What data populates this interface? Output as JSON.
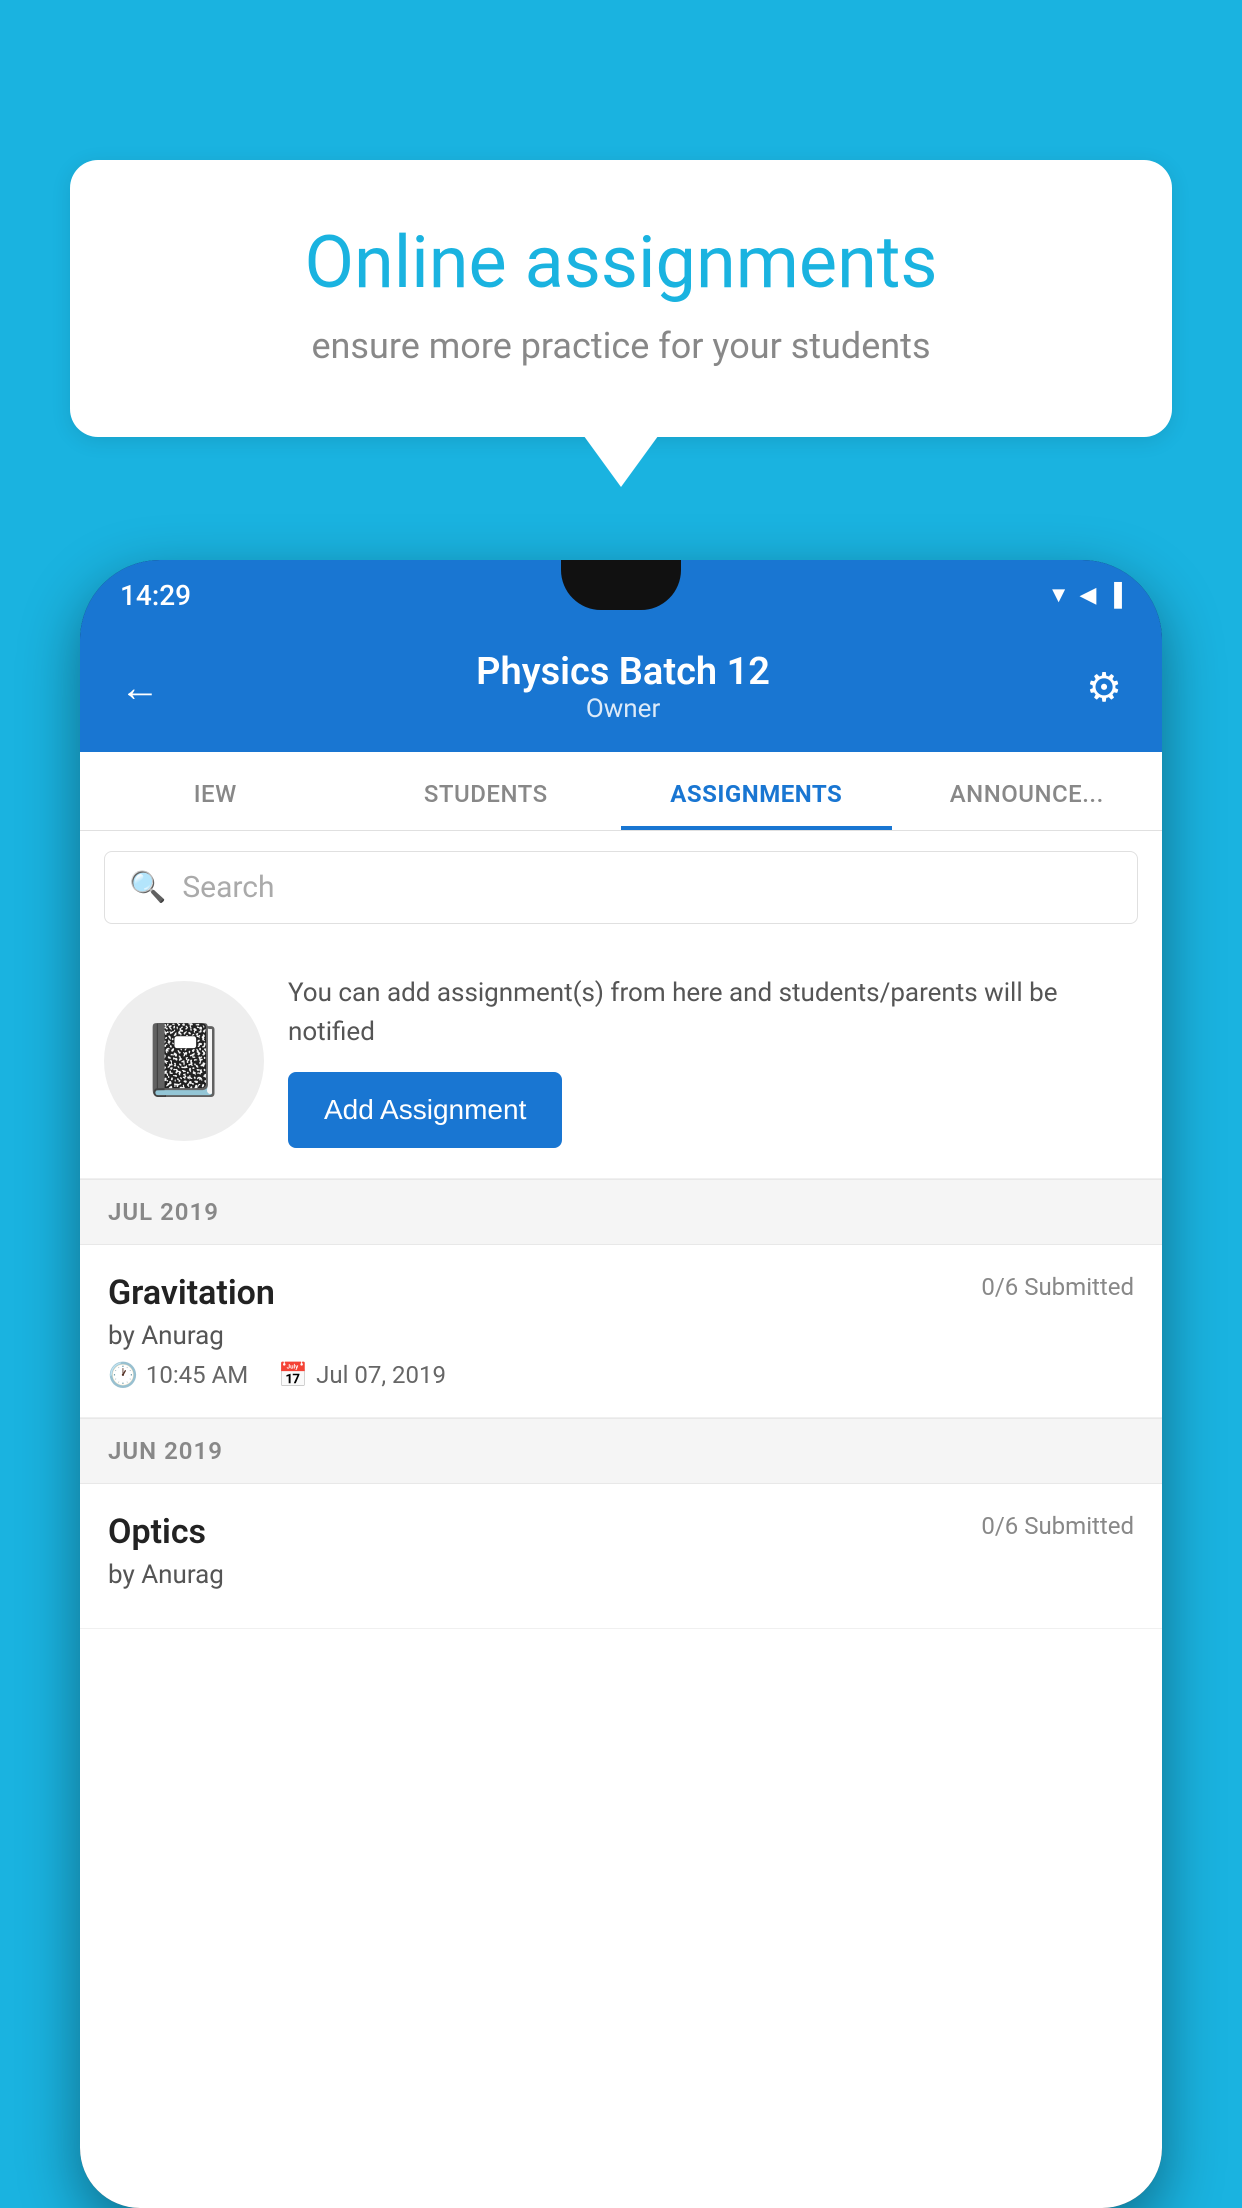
{
  "background_color": "#1ab3e0",
  "speech_bubble": {
    "title": "Online assignments",
    "subtitle": "ensure more practice for your students"
  },
  "phone": {
    "status_bar": {
      "time": "14:29",
      "icons": "▼◀▐"
    },
    "header": {
      "title": "Physics Batch 12",
      "subtitle": "Owner",
      "back_label": "←",
      "settings_label": "⚙"
    },
    "tabs": [
      {
        "label": "IEW",
        "active": false
      },
      {
        "label": "STUDENTS",
        "active": false
      },
      {
        "label": "ASSIGNMENTS",
        "active": true
      },
      {
        "label": "ANNOUNCEMENTS",
        "active": false
      }
    ],
    "search": {
      "placeholder": "Search"
    },
    "promo": {
      "icon": "📓",
      "text": "You can add assignment(s) from here and students/parents will be notified",
      "button_label": "Add Assignment"
    },
    "sections": [
      {
        "header": "JUL 2019",
        "items": [
          {
            "name": "Gravitation",
            "submitted": "0/6 Submitted",
            "by": "by Anurag",
            "time": "10:45 AM",
            "date": "Jul 07, 2019"
          }
        ]
      },
      {
        "header": "JUN 2019",
        "items": [
          {
            "name": "Optics",
            "submitted": "0/6 Submitted",
            "by": "by Anurag",
            "time": "",
            "date": ""
          }
        ]
      }
    ]
  }
}
